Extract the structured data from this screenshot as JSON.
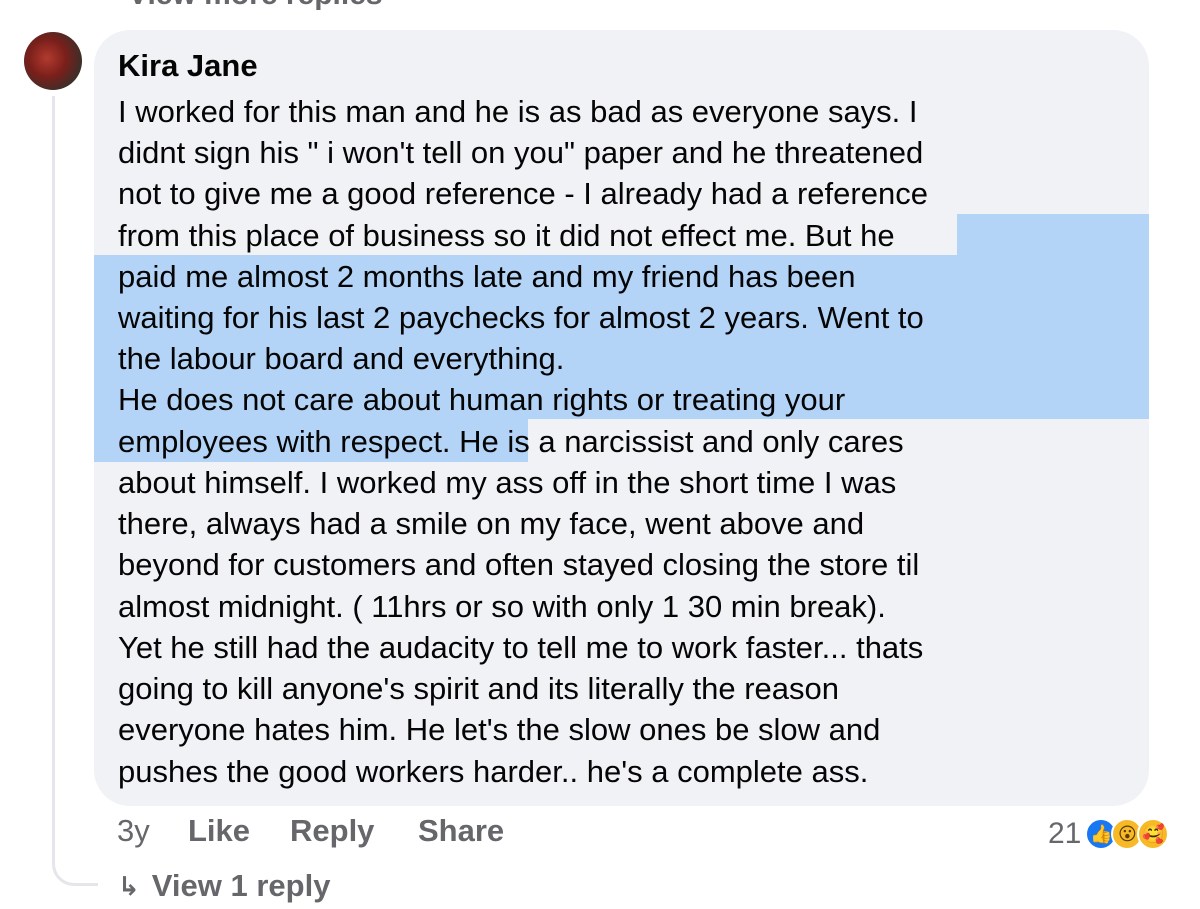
{
  "top": {
    "partial_label": "View more replies"
  },
  "comment": {
    "author": "Kira Jane",
    "lines": [
      "I worked for this man and he is as bad as everyone says. I",
      "didnt sign his \" i won't tell on you\" paper and he threatened",
      "not to give me a good reference - I already had a reference",
      "from this place of business so it did not effect me. But he",
      "paid me almost 2 months late and my friend has been",
      "waiting for his last 2 paychecks for almost 2 years. Went to",
      "the labour board and everything.",
      "He does not care about human rights or treating your",
      "employees with respect. He is a narcissist and only cares",
      "about himself. I worked my ass off in the short time I was",
      "there, always had a smile on my face, went above and",
      "beyond for customers and often stayed closing the store til",
      "almost midnight. ( 11hrs or so with only 1 30 min break).",
      "Yet he still had the audacity to tell me to work faster... thats",
      "going to kill anyone's spirit and its literally the reason",
      "everyone hates him. He let's the slow ones be slow and",
      "pushes the good workers harder.. he's a complete ass."
    ],
    "highlighted_text": "But he paid me almost 2 months late and my friend has been waiting for his last 2 paychecks for almost 2 years. Went to the labour board and everything. He does not care about human rights or treating your employees with respect."
  },
  "actions": {
    "time": "3y",
    "like": "Like",
    "reply": "Reply",
    "share": "Share"
  },
  "reactions": {
    "count": "21",
    "icons": [
      "like-icon",
      "wow-icon",
      "care-icon"
    ]
  },
  "replies": {
    "view_label": "View 1 reply"
  },
  "colors": {
    "bubble": "#f0f2f5",
    "highlight": "#b3d3f7",
    "secondary_text": "#65676b",
    "like_blue": "#1877f2"
  }
}
